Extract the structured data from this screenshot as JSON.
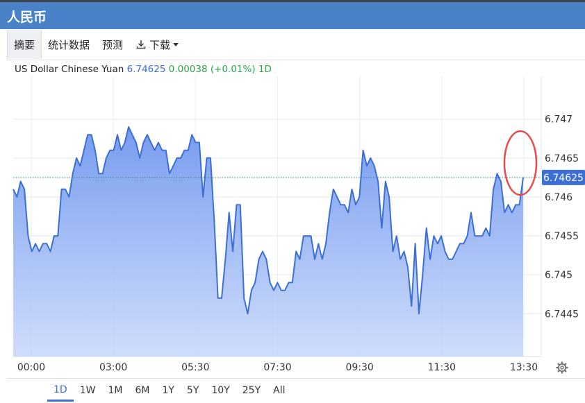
{
  "header": {
    "title": "人民币"
  },
  "tabs": [
    {
      "label": "摘要",
      "active": true
    },
    {
      "label": "统计数据",
      "active": false
    },
    {
      "label": "预测",
      "active": false
    },
    {
      "label": "下载",
      "active": false,
      "icon": "download-icon",
      "dropdown": true
    }
  ],
  "quote": {
    "name": "US Dollar Chinese Yuan",
    "price": "6.74625",
    "change": "0.00038",
    "change_pct": "(+0.01%)",
    "period": "1D"
  },
  "ranges": [
    "1D",
    "1W",
    "1M",
    "6M",
    "1Y",
    "5Y",
    "10Y",
    "25Y",
    "All"
  ],
  "active_range": "1D",
  "colors": {
    "header": "#4a82c8",
    "line": "#3b6fd6",
    "fill": "#7ea6f2",
    "positive": "#2aa845",
    "marker_circle": "#e84a4a"
  },
  "chart_data": {
    "type": "area",
    "title": "",
    "xlabel": "",
    "ylabel": "",
    "x_ticks": [
      "00:00",
      "03:00",
      "05:30",
      "07:30",
      "09:30",
      "11:30",
      "13:30"
    ],
    "y_ticks": [
      "6.747",
      "6.7465",
      "6.746",
      "6.7455",
      "6.745",
      "6.7445"
    ],
    "ylim": [
      6.74395,
      6.74755
    ],
    "last_value_label": "6.74625",
    "reference_line": 6.74625,
    "grid": true,
    "series": [
      {
        "values": [
          6.7461,
          6.746,
          6.7462,
          6.7461,
          6.7455,
          6.7453,
          6.7454,
          6.7453,
          6.7454,
          6.7454,
          6.7453,
          6.7455,
          6.7455,
          6.7461,
          6.7461,
          6.746,
          6.7463,
          6.7465,
          6.7464,
          6.7466,
          6.7468,
          6.7468,
          6.7466,
          6.7463,
          6.7463,
          6.7465,
          6.7466,
          6.7466,
          6.7468,
          6.7466,
          6.7467,
          6.7469,
          6.7468,
          6.7467,
          6.7465,
          6.7467,
          6.7468,
          6.7467,
          6.7466,
          6.7467,
          6.7466,
          6.7466,
          6.7463,
          6.7464,
          6.7465,
          6.7465,
          6.7466,
          6.7466,
          6.7468,
          6.7467,
          6.7467,
          6.746,
          6.7465,
          6.7465,
          6.7457,
          6.7447,
          6.7447,
          6.7452,
          6.7458,
          6.7453,
          6.7459,
          6.7459,
          6.7447,
          6.7445,
          6.7448,
          6.7449,
          6.7452,
          6.7453,
          6.7452,
          6.7449,
          6.7448,
          6.7449,
          6.7448,
          6.7448,
          6.7449,
          6.7449,
          6.7453,
          6.7452,
          6.7455,
          6.7455,
          6.7455,
          6.7452,
          6.7454,
          6.7452,
          6.7454,
          6.7458,
          6.7461,
          6.746,
          6.7459,
          6.7459,
          6.7458,
          6.7461,
          6.7459,
          6.746,
          6.7466,
          6.7464,
          6.7465,
          6.7464,
          6.7462,
          6.7456,
          6.7462,
          6.746,
          6.7453,
          6.7455,
          6.7452,
          6.7453,
          6.7451,
          6.7446,
          6.7454,
          6.7445,
          6.745,
          6.7456,
          6.7452,
          6.7455,
          6.7454,
          6.7455,
          6.7453,
          6.7452,
          6.7452,
          6.7453,
          6.7454,
          6.7454,
          6.7455,
          6.7458,
          6.7455,
          6.7455,
          6.7455,
          6.7456,
          6.7455,
          6.7461,
          6.7463,
          6.7462,
          6.7458,
          6.7459,
          6.7458,
          6.7459,
          6.7459,
          6.74625
        ]
      }
    ]
  }
}
